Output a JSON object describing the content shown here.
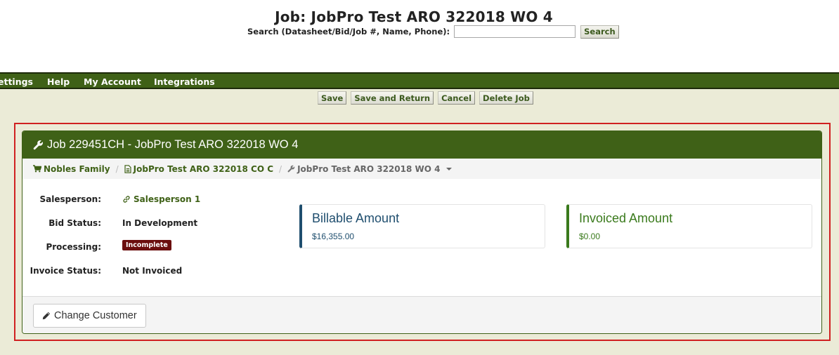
{
  "header": {
    "title": "Job: JobPro Test ARO 322018 WO 4",
    "search_label": "Search (Datasheet/Bid/Job #, Name, Phone):",
    "search_value": "",
    "search_button": "Search"
  },
  "nav": {
    "items": [
      {
        "label": "ettings"
      },
      {
        "label": "Help"
      },
      {
        "label": "My Account"
      },
      {
        "label": "Integrations"
      }
    ]
  },
  "toolbar": {
    "save": "Save",
    "save_and_return": "Save and Return",
    "cancel": "Cancel",
    "delete_job": "Delete Job"
  },
  "panel": {
    "title": "Job 229451CH - JobPro Test ARO 322018 WO 4",
    "breadcrumb": [
      {
        "label": "Nobles Family",
        "icon": "cart-icon"
      },
      {
        "label": "JobPro Test ARO 322018 CO C",
        "icon": "document-icon"
      },
      {
        "label": "JobPro Test ARO 322018 WO 4",
        "icon": "wrench-icon"
      }
    ],
    "details": [
      {
        "label": "Salesperson:",
        "value": "Salesperson 1"
      },
      {
        "label": "Bid Status:",
        "value": "In Development"
      },
      {
        "label": "Processing:",
        "value": "Incomplete"
      },
      {
        "label": "Invoice Status:",
        "value": "Not Invoiced"
      }
    ],
    "cards": [
      {
        "title": "Billable Amount",
        "value": "$16,355.00",
        "color": "#1f4e6e"
      },
      {
        "title": "Invoiced Amount",
        "value": "$0.00",
        "color": "#3a7a1c"
      }
    ],
    "footer_button": "Change Customer"
  },
  "colors": {
    "brand_green": "#3f6117",
    "content_bg": "#ebebd7",
    "highlight_red": "#d02020",
    "badge_red": "#6b0e0e"
  }
}
